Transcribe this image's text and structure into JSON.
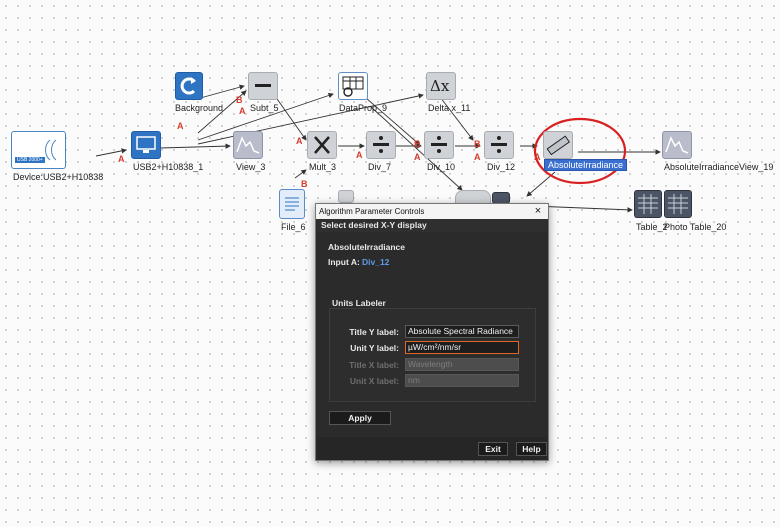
{
  "nodes": {
    "background": "Background",
    "subt5": "Subt_5",
    "dataprop9": "DataProp_9",
    "deltax11": "Delta x_11",
    "device": "Device:USB2+H10838",
    "usb_node": "USB2+H10838_1",
    "view3": "View_3",
    "mult3": "Mult_3",
    "div7": "Div_7",
    "div10": "Div_10",
    "div12": "Div_12",
    "absolute": "AbsoluteIrradiance",
    "absview": "AbsoluteIrradianceView_19",
    "file6": "File_6",
    "table": "Table_2",
    "photo_table": "Photo Table_20",
    "device_icon_text": "USB 2000+",
    "delta_glyph": "Δx",
    "port_a": "A",
    "port_b": "B"
  },
  "dialog": {
    "title": "Algorithm Parameter Controls",
    "close": "×",
    "subtitle": "Select desired X-Y display",
    "algorithm": "AbsoluteIrradiance",
    "input_label": "Input A:",
    "input_link": "Div_12",
    "group_title": "Units Labeler",
    "fields": {
      "title_y_label": "Title Y label:",
      "title_y_value": "Absolute Spectral Radiance",
      "unit_y_label": "Unit Y label:",
      "unit_y_value": "µW/cm²/nm/sr",
      "title_x_label": "Title X label:",
      "title_x_value": "Wavelength",
      "unit_x_label": "Unit X label:",
      "unit_x_value": "nm"
    },
    "apply": "Apply",
    "exit": "Exit",
    "help": "Help"
  },
  "colors": {
    "port": "#d63b2b",
    "connector": "#333333",
    "highlight_circle": "#d92020",
    "selection": "#3a6fd0",
    "dialog_bg": "#2b2b2b",
    "focus_border": "#e0662c",
    "link": "#5e9be8"
  }
}
